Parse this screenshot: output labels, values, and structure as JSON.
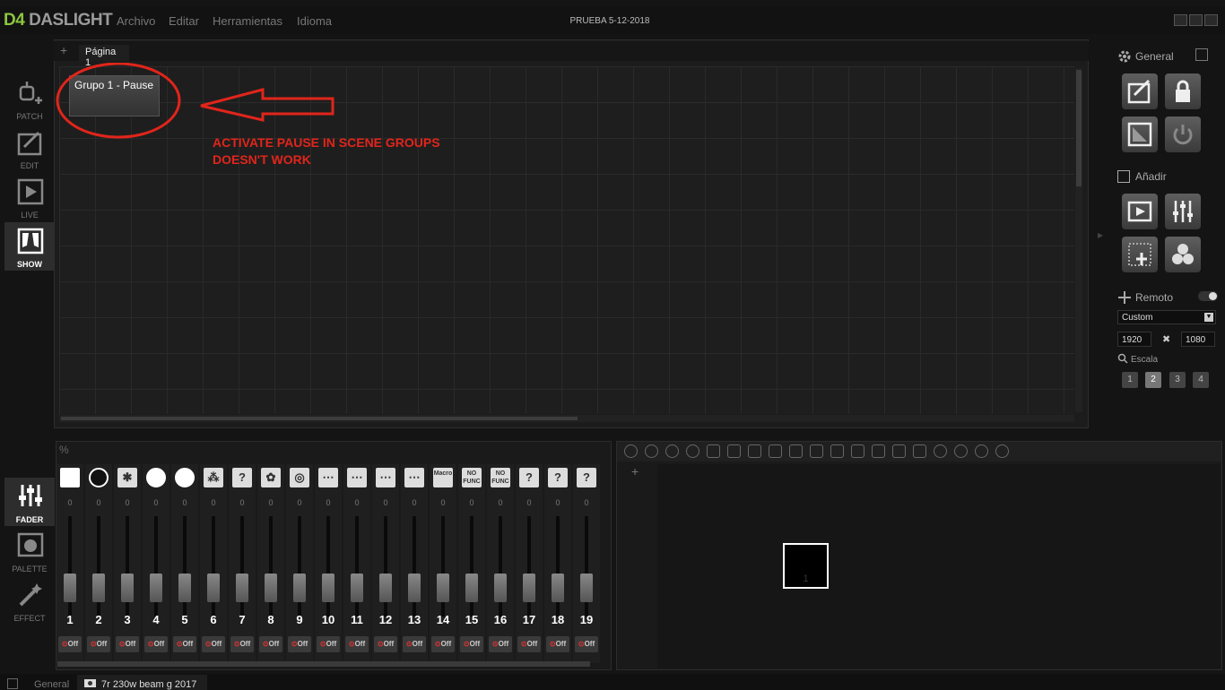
{
  "app": {
    "logo_mark": "D4",
    "logo_text": "DASLIGHT",
    "window_title": "PRUEBA 5-12-2018"
  },
  "menu": [
    "Archivo",
    "Editar",
    "Herramientas",
    "Idioma"
  ],
  "nav_top": [
    {
      "label": "PATCH",
      "icon": "patch-icon"
    },
    {
      "label": "EDIT",
      "icon": "edit-icon"
    },
    {
      "label": "LIVE",
      "icon": "live-icon"
    },
    {
      "label": "SHOW",
      "icon": "show-icon",
      "active": true
    }
  ],
  "nav_bottom": [
    {
      "label": "FADER",
      "icon": "fader-icon",
      "active": true
    },
    {
      "label": "PALETTE",
      "icon": "palette-icon"
    },
    {
      "label": "EFFECT",
      "icon": "effect-icon"
    }
  ],
  "show": {
    "add_page": "+",
    "page_tab": "Página 1",
    "scene_group": "Grupo 1 - Pause",
    "annotation_line1": "ACTIVATE PAUSE IN SCENE GROUPS",
    "annotation_line2": "DOESN'T WORK",
    "annotation_color": "#e1251b"
  },
  "right_panel": {
    "general": "General",
    "anadir": "Añadir",
    "remoto": "Remoto",
    "resolution_preset": "Custom",
    "width": "1920",
    "times": "✖",
    "height": "1080",
    "escala": "Escala",
    "scales": [
      "1",
      "2",
      "3",
      "4"
    ],
    "selected_scale": "2"
  },
  "fader": {
    "percent": "%",
    "channels": [
      {
        "num": "1",
        "value": "0",
        "icon": "□",
        "off": "Off"
      },
      {
        "num": "2",
        "value": "0",
        "icon": "○",
        "off": "Off"
      },
      {
        "num": "3",
        "value": "0",
        "icon": "✱",
        "off": "Off"
      },
      {
        "num": "4",
        "value": "0",
        "icon": "●",
        "off": "Off"
      },
      {
        "num": "5",
        "value": "0",
        "icon": "●",
        "off": "Off"
      },
      {
        "num": "6",
        "value": "0",
        "icon": "⁂",
        "off": "Off"
      },
      {
        "num": "7",
        "value": "0",
        "icon": "?",
        "off": "Off"
      },
      {
        "num": "8",
        "value": "0",
        "icon": "✿",
        "off": "Off"
      },
      {
        "num": "9",
        "value": "0",
        "icon": "◎",
        "off": "Off"
      },
      {
        "num": "10",
        "value": "0",
        "icon": "⋯",
        "off": "Off"
      },
      {
        "num": "11",
        "value": "0",
        "icon": "⋯",
        "off": "Off"
      },
      {
        "num": "12",
        "value": "0",
        "icon": "⋯",
        "off": "Off"
      },
      {
        "num": "13",
        "value": "0",
        "icon": "⋯",
        "off": "Off"
      },
      {
        "num": "14",
        "value": "0",
        "icon": "Macro",
        "off": "Off"
      },
      {
        "num": "15",
        "value": "0",
        "icon": "NO FUNC",
        "off": "Off"
      },
      {
        "num": "16",
        "value": "0",
        "icon": "NO FUNC",
        "off": "Off"
      },
      {
        "num": "17",
        "value": "0",
        "icon": "?",
        "off": "Off"
      },
      {
        "num": "18",
        "value": "0",
        "icon": "?",
        "off": "Off"
      },
      {
        "num": "19",
        "value": "0",
        "icon": "?",
        "off": "Off"
      }
    ]
  },
  "stage": {
    "add": "+",
    "fixture_number": "1"
  },
  "status_bar": {
    "general": "General",
    "fixture_tab": "7r 230w beam g 2017"
  }
}
